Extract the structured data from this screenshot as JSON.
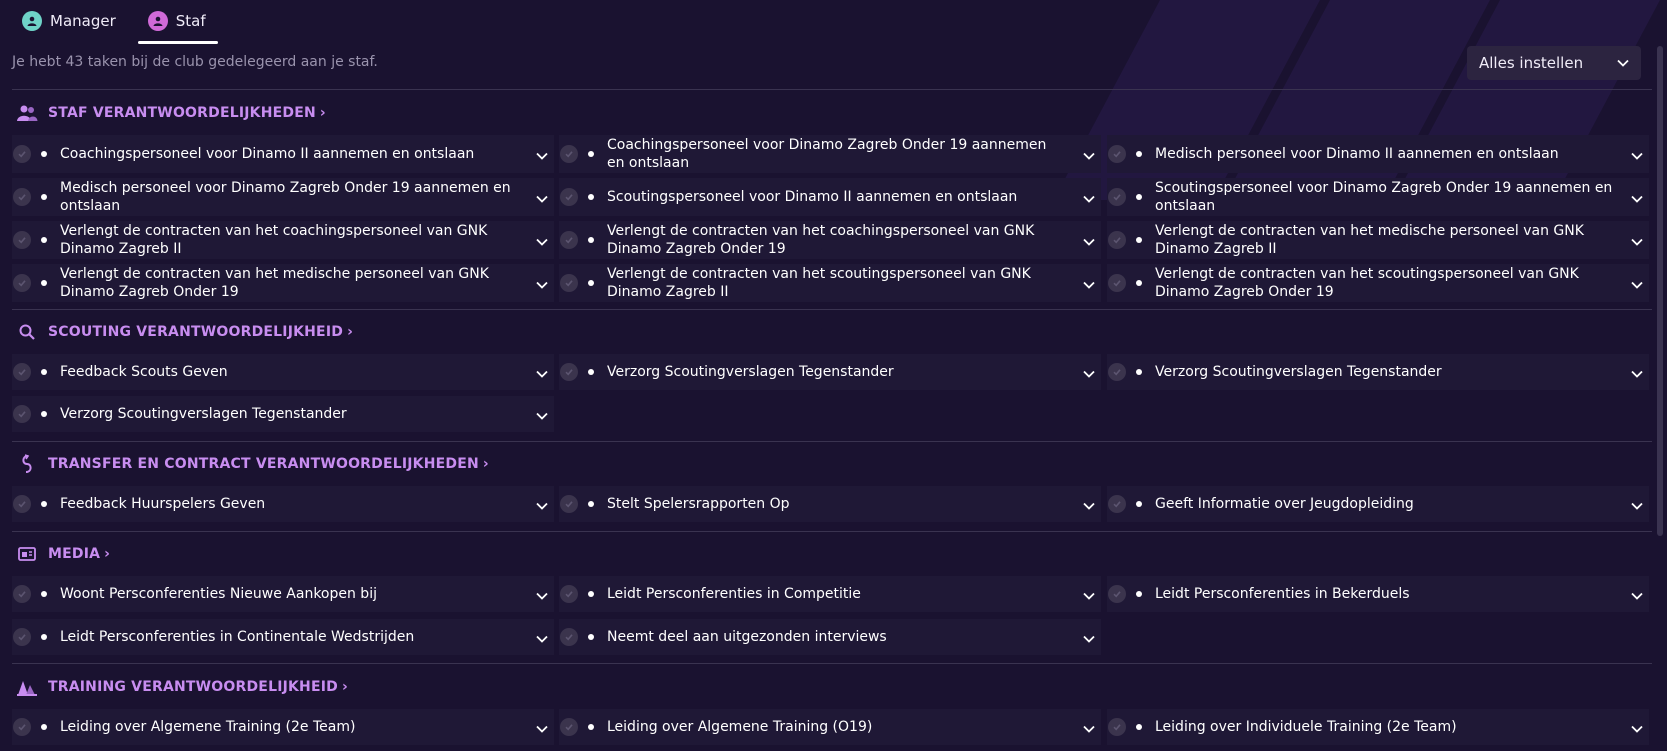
{
  "tabs": [
    {
      "label": "Manager",
      "icon": "manager-person-icon"
    },
    {
      "label": "Staf",
      "icon": "staff-person-icon"
    }
  ],
  "summary": "Je hebt 43 taken bij de club gedelegeerd aan je staf.",
  "select_all_label": "Alles instellen",
  "colors": {
    "accent": "#c88df0",
    "background": "#1a1230",
    "item_bg": "#1f1836"
  },
  "sections": [
    {
      "title": "STAF VERANTWOORDELIJKHEDEN",
      "icon": "staff-group-icon",
      "items": [
        "Coachingspersoneel voor Dinamo II aannemen en ontslaan",
        "Coachingspersoneel voor Dinamo Zagreb Onder 19 aannemen en ontslaan",
        "Medisch personeel voor Dinamo II aannemen en ontslaan",
        "Medisch personeel voor Dinamo Zagreb Onder 19 aannemen en ontslaan",
        "Scoutingspersoneel voor Dinamo II aannemen en ontslaan",
        "Scoutingspersoneel voor Dinamo Zagreb Onder 19 aannemen en ontslaan",
        "Verlengt de contracten van het coachingspersoneel van GNK Dinamo Zagreb II",
        "Verlengt de contracten van het coachingspersoneel van GNK Dinamo Zagreb Onder 19",
        "Verlengt de contracten van het medische personeel van GNK Dinamo Zagreb II",
        "Verlengt de contracten van het medische personeel van GNK Dinamo Zagreb Onder 19",
        "Verlengt de contracten van het scoutingspersoneel van GNK Dinamo Zagreb II",
        "Verlengt de contracten van het scoutingspersoneel van GNK Dinamo Zagreb Onder 19"
      ]
    },
    {
      "title": "SCOUTING VERANTWOORDELIJKHEID",
      "icon": "search-icon",
      "items": [
        "Feedback Scouts Geven",
        "Verzorg Scoutingverslagen Tegenstander",
        "Verzorg Scoutingverslagen Tegenstander",
        "Verzorg Scoutingverslagen Tegenstander"
      ]
    },
    {
      "title": "TRANSFER EN CONTRACT VERANTWOORDELIJKHEDEN",
      "icon": "transfer-arrows-icon",
      "items": [
        "Feedback Huurspelers Geven",
        "Stelt Spelersrapporten Op",
        "Geeft Informatie over Jeugdopleiding"
      ]
    },
    {
      "title": "MEDIA",
      "icon": "media-icon",
      "items": [
        "Woont Persconferenties Nieuwe Aankopen bij",
        "Leidt Persconferenties in Competitie",
        "Leidt Persconferenties in Bekerduels",
        "Leidt Persconferenties in Continentale Wedstrijden",
        "Neemt deel aan uitgezonden interviews"
      ]
    },
    {
      "title": "TRAINING VERANTWOORDELIJKHEID",
      "icon": "training-cones-icon",
      "items": [
        "Leiding over Algemene Training (2e Team)",
        "Leiding over Algemene Training (O19)",
        "Leiding over Individuele Training (2e Team)"
      ]
    }
  ]
}
